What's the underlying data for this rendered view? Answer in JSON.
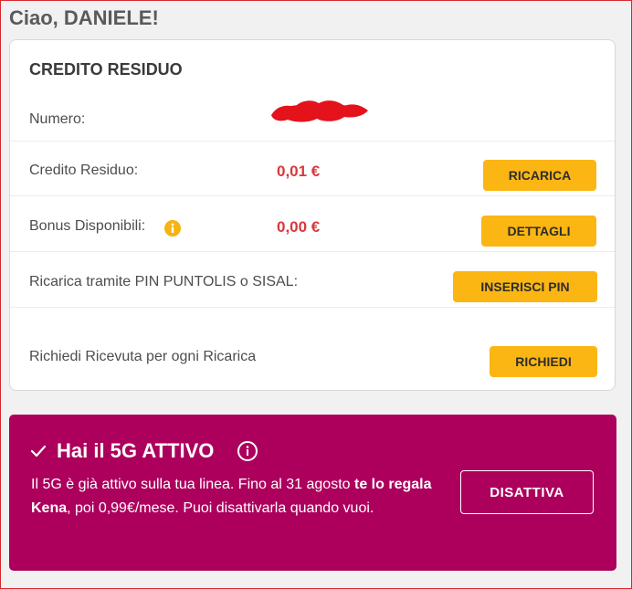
{
  "greeting": "Ciao, DANIELE!",
  "credit": {
    "title": "CREDITO RESIDUO",
    "numero_label": "Numero:",
    "credito_label": "Credito Residuo:",
    "credito_value": "0,01 €",
    "ricarica_button": "RICARICA",
    "bonus_label": "Bonus Disponibili:",
    "bonus_value": "0,00 €",
    "dettagli_button": "DETTAGLI",
    "pin_label": "Ricarica tramite PIN PUNTOLIS o SISAL:",
    "pin_button": "INSERISCI PIN",
    "ricevuta_label": "Richiedi Ricevuta per ogni Ricarica",
    "richiedi_button": "RICHIEDI"
  },
  "promo": {
    "title": "Hai il 5G ATTIVO",
    "text_part1": "Il 5G è già attivo sulla tua linea. Fino al 31 agosto ",
    "text_bold": "te lo regala Kena",
    "text_part2": ", poi 0,99€/mese. Puoi disattivarla quando vuoi.",
    "button": "DISATTIVA"
  },
  "colors": {
    "accent_yellow": "#fbb614",
    "value_red": "#d9373c",
    "promo_magenta": "#ad005d"
  },
  "icons": [
    "info-icon",
    "check-icon",
    "info-outline-icon"
  ]
}
